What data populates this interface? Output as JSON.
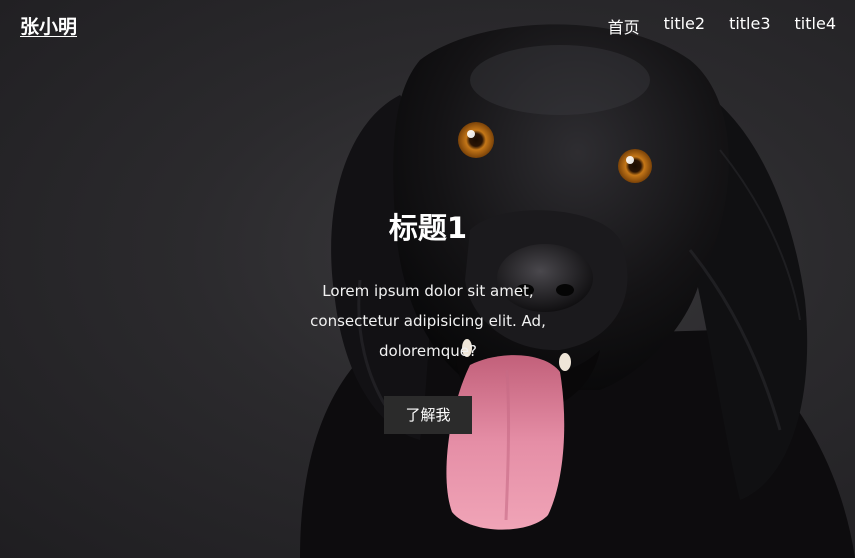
{
  "brand": {
    "name": "张小明"
  },
  "nav": {
    "items": [
      {
        "label": "首页"
      },
      {
        "label": "title2"
      },
      {
        "label": "title3"
      },
      {
        "label": "title4"
      }
    ]
  },
  "hero": {
    "title": "标题1",
    "description": "Lorem ipsum dolor sit amet, consectetur adipisicing elit. Ad, doloremque?",
    "cta_label": "了解我"
  },
  "colors": {
    "background": "#2a292c",
    "button_bg": "#2b2b2b",
    "text": "#ffffff",
    "dog_eye": "#d98a1f",
    "dog_tongue": "#e8879f"
  },
  "background_image": {
    "subject": "black-dog-photo"
  }
}
